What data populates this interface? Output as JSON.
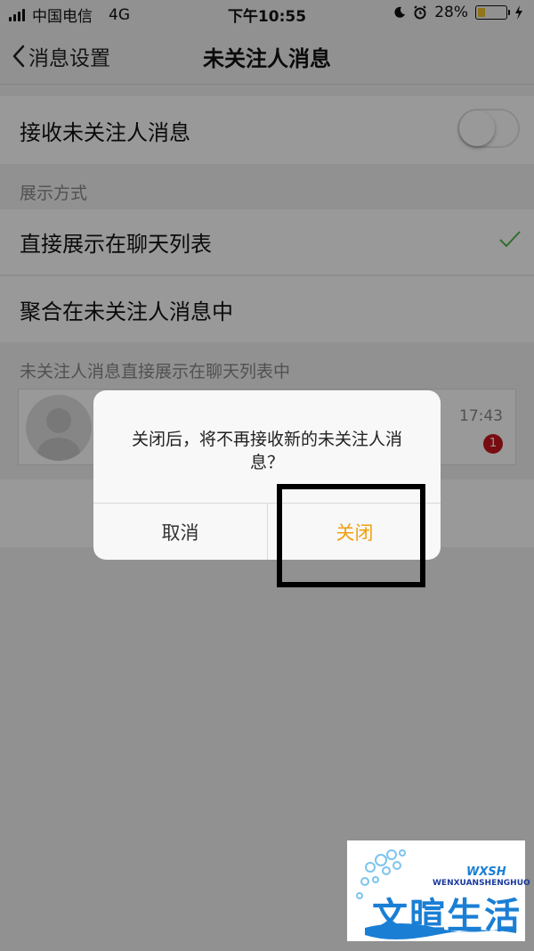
{
  "status_bar": {
    "carrier": "中国电信",
    "network": "4G",
    "time": "下午10:55",
    "battery_percent": "28%",
    "battery_level": 0.28
  },
  "nav": {
    "back_label": "消息设置",
    "title": "未关注人消息"
  },
  "settings": {
    "receive_label": "接收未关注人消息",
    "receive_enabled": false,
    "display_section_label": "展示方式",
    "option_direct": "直接展示在聊天列表",
    "option_aggregate": "聚合在未关注人消息中",
    "selected_option": "直接展示在聊天列表",
    "preview_label": "未关注人消息直接展示在聊天列表中",
    "preview_time": "17:43",
    "preview_badge": "1"
  },
  "dialog": {
    "message": "关闭后，将不再接收新的未关注人消息？",
    "cancel_label": "取消",
    "close_label": "关闭"
  },
  "watermark": {
    "text": "文暄生活",
    "subtitle": "WENXUANSHENGHUO",
    "badge": "WXSH"
  },
  "colors": {
    "accent": "#f0a010",
    "check": "#4cb84a",
    "badge": "#c8171d",
    "watermark": "#1a7fd4"
  }
}
